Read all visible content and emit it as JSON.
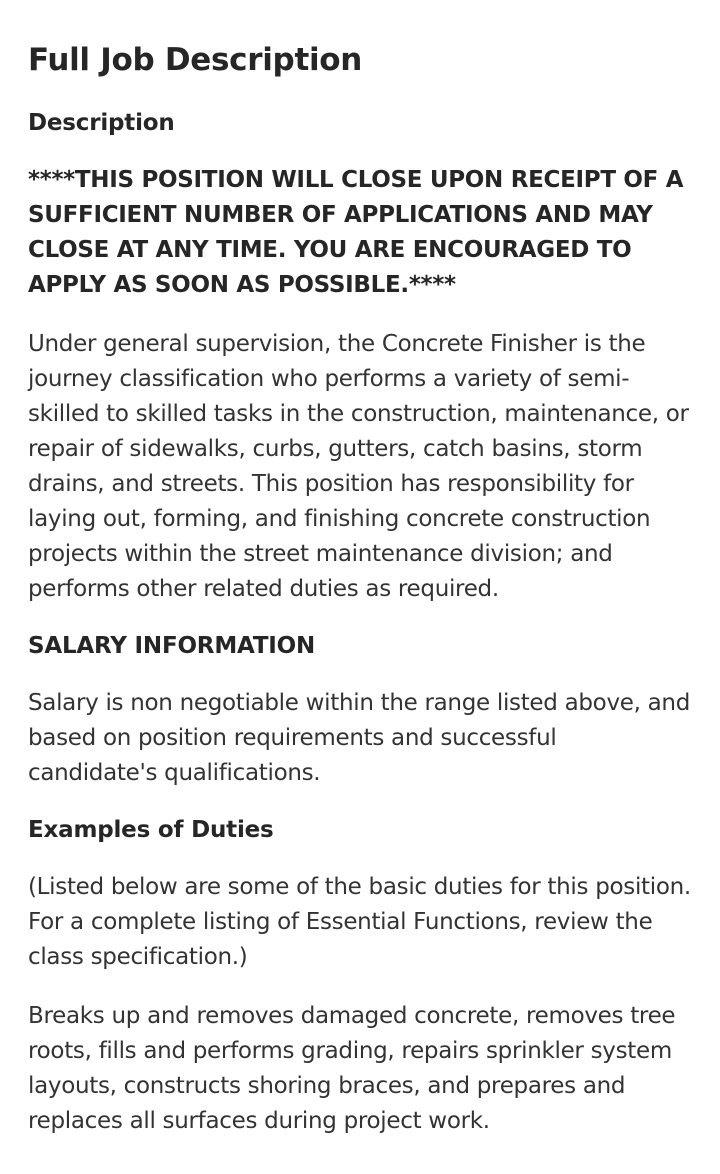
{
  "page_title": "Full Job Description",
  "sections": {
    "description": {
      "heading": "Description",
      "notice": "****THIS POSITION WILL CLOSE UPON RECEIPT OF A SUFFICIENT NUMBER OF APPLICATIONS AND MAY CLOSE AT ANY TIME. YOU ARE ENCOURAGED TO APPLY AS SOON AS POSSIBLE.****",
      "body": "Under general supervision, the Concrete Finisher is the journey classification who performs a variety of semi-skilled to skilled tasks in the construction, maintenance, or repair of sidewalks, curbs, gutters, catch basins, storm drains, and streets. This position has responsibility for laying out, forming, and finishing concrete construction projects within the street maintenance division; and performs other related duties as required."
    },
    "salary": {
      "heading": "SALARY INFORMATION",
      "body": "Salary is non negotiable within the range listed above, and based on position requirements and successful candidate's qualifications."
    },
    "duties": {
      "heading": "Examples of Duties",
      "intro": "(Listed below are some of the basic duties for this position. For a complete listing of Essential Functions, review the class specification.)",
      "body": "Breaks up and removes damaged concrete, removes tree roots, fills and performs grading, repairs sprinkler system layouts, constructs shoring braces, and prepares and replaces all surfaces during project work."
    }
  }
}
